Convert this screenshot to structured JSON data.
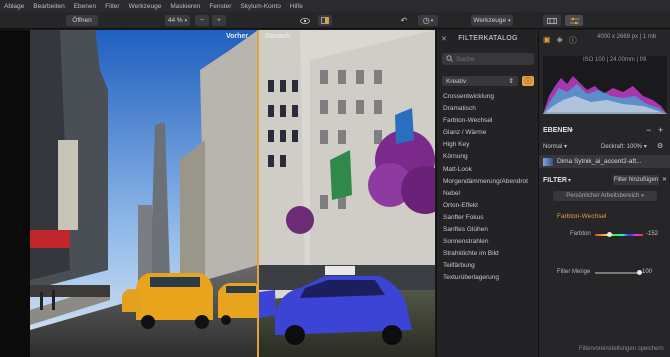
{
  "menu": [
    "Ablage",
    "Bearbeiten",
    "Ebenen",
    "Filter",
    "Werkzeuge",
    "Maskieren",
    "Fenster",
    "Skylum-Konto",
    "Hilfe"
  ],
  "toolbar": {
    "open_label": "Öffnen",
    "zoom": "44 %",
    "zoom_minus": "−",
    "zoom_plus": "+",
    "tools_label": "Werkzeuge"
  },
  "viewer": {
    "before": "Vorher",
    "after": "Danach"
  },
  "catalog": {
    "title": "FILTERKATALOG",
    "search_placeholder": "Suche",
    "category": "Kreativ",
    "filters": [
      "Crossentwicklung",
      "Dramatisch",
      "Farbton-Wechsel",
      "Glanz / Wärme",
      "High Key",
      "Körnung",
      "Matt-Look",
      "Morgendämmerung/Abendrot",
      "Nebel",
      "Orton-Effekt",
      "Sanfter Fokus",
      "Sanftes Glühen",
      "Sonnenstrahlen",
      "Strahldichte im Bild",
      "Teilfärbung",
      "Texturüberlagerung"
    ]
  },
  "right": {
    "image_info": "4000 x 2669 px | 1 mb",
    "exif": "ISO 100 | 24.00mm | f/8",
    "layers_title": "EBENEN",
    "blend": "Normal",
    "opacity": "Deckraft: 100%",
    "layer_name": "Dima Sytnik_ai_accent2-aft...",
    "filter_title": "FILTER",
    "add_filter": "Filter hinzufügen",
    "workspace": "Persönlicher Arbeitsbereich",
    "filter_name": "Farbton-Wechsel",
    "hue_label": "Farbton",
    "hue_value": "-152",
    "hue_level": 0.3,
    "amount_label": "Filter Menge",
    "amount_value": "100",
    "amount_level": 1.0,
    "save_presets": "Filtervoreinstellungen speichern"
  },
  "colors": {
    "accent": "#e0a23a",
    "panel": "#262629",
    "menubar": "#2b2b2e"
  }
}
